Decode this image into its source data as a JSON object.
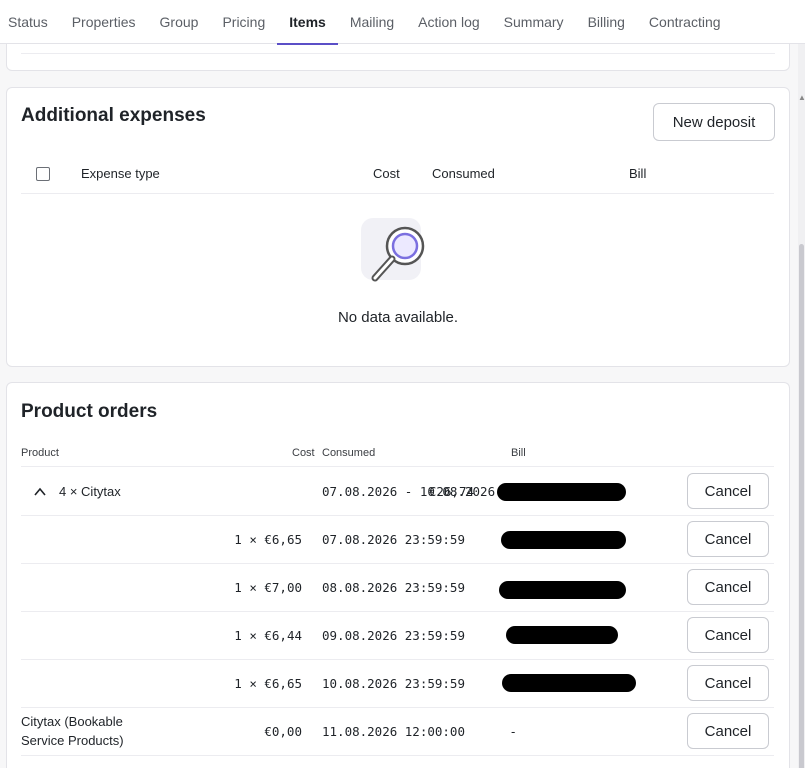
{
  "tabs": [
    "Status",
    "Properties",
    "Group",
    "Pricing",
    "Items",
    "Mailing",
    "Action log",
    "Summary",
    "Billing",
    "Contracting"
  ],
  "active_tab": "Items",
  "expenses": {
    "title": "Additional expenses",
    "new_deposit_label": "New deposit",
    "columns": {
      "expense_type": "Expense type",
      "cost": "Cost",
      "consumed": "Consumed",
      "bill": "Bill"
    },
    "empty_text": "No data available."
  },
  "orders": {
    "title": "Product orders",
    "columns": {
      "product": "Product",
      "cost": "Cost",
      "consumed": "Consumed",
      "bill": "Bill"
    },
    "cancel_label": "Cancel",
    "rows": [
      {
        "product": "4 × Citytax",
        "cost": "€26,74",
        "consumed": "07.08.2026 - 10.08.2026",
        "bill": ""
      },
      {
        "product": "",
        "cost": "1 × €6,65",
        "consumed": "07.08.2026 23:59:59",
        "bill": ""
      },
      {
        "product": "",
        "cost": "1 × €7,00",
        "consumed": "08.08.2026 23:59:59",
        "bill": ""
      },
      {
        "product": "",
        "cost": "1 × €6,44",
        "consumed": "09.08.2026 23:59:59",
        "bill": ""
      },
      {
        "product": "",
        "cost": "1 × €6,65",
        "consumed": "10.08.2026 23:59:59",
        "bill": ""
      },
      {
        "product_line1": "Citytax (Bookable",
        "product_line2": "Service Products)",
        "cost": "€0,00",
        "consumed": "11.08.2026 12:00:00",
        "bill": "-"
      }
    ]
  },
  "colors": {
    "accent": "#5b4fc7",
    "redaction": "#000000"
  },
  "icons": {
    "expand_row": "chevron-up-icon",
    "empty_state": "magnifier-icon"
  }
}
